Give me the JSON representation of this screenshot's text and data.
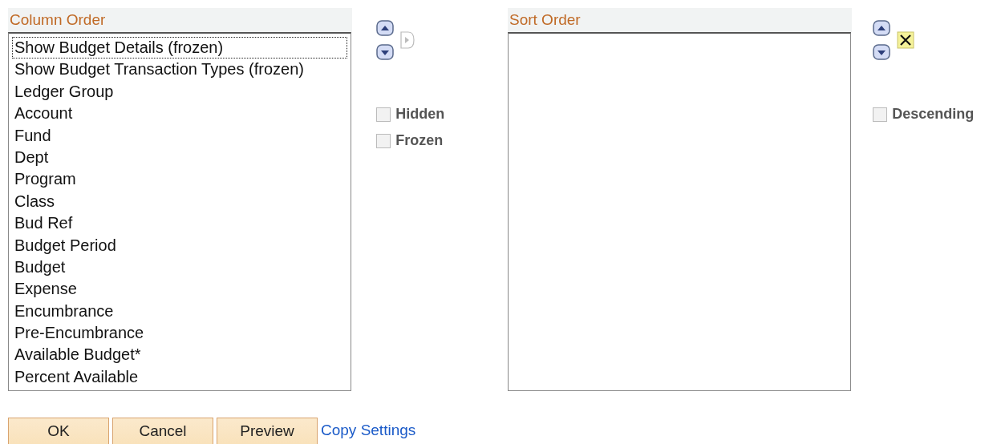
{
  "column_order": {
    "title": "Column Order",
    "items": [
      {
        "label": "Show Budget Details (frozen)",
        "focused": true
      },
      {
        "label": "Show Budget Transaction Types (frozen)",
        "focused": false
      },
      {
        "label": "Ledger Group",
        "focused": false
      },
      {
        "label": "Account",
        "focused": false
      },
      {
        "label": "Fund",
        "focused": false
      },
      {
        "label": "Dept",
        "focused": false
      },
      {
        "label": "Program",
        "focused": false
      },
      {
        "label": "Class",
        "focused": false
      },
      {
        "label": "Bud Ref",
        "focused": false
      },
      {
        "label": "Budget Period",
        "focused": false
      },
      {
        "label": "Budget",
        "focused": false
      },
      {
        "label": "Expense",
        "focused": false
      },
      {
        "label": "Encumbrance",
        "focused": false
      },
      {
        "label": "Pre-Encumbrance",
        "focused": false
      },
      {
        "label": "Available Budget*",
        "focused": false
      },
      {
        "label": "Percent Available",
        "focused": false
      }
    ],
    "options": [
      {
        "label": "Hidden",
        "checked": false,
        "disabled": true
      },
      {
        "label": "Frozen",
        "checked": false,
        "disabled": true
      }
    ]
  },
  "sort_order": {
    "title": "Sort Order",
    "options": [
      {
        "label": "Descending",
        "checked": false,
        "disabled": true
      }
    ]
  },
  "buttons": [
    "OK",
    "Cancel",
    "Preview"
  ],
  "link": "Copy Settings"
}
